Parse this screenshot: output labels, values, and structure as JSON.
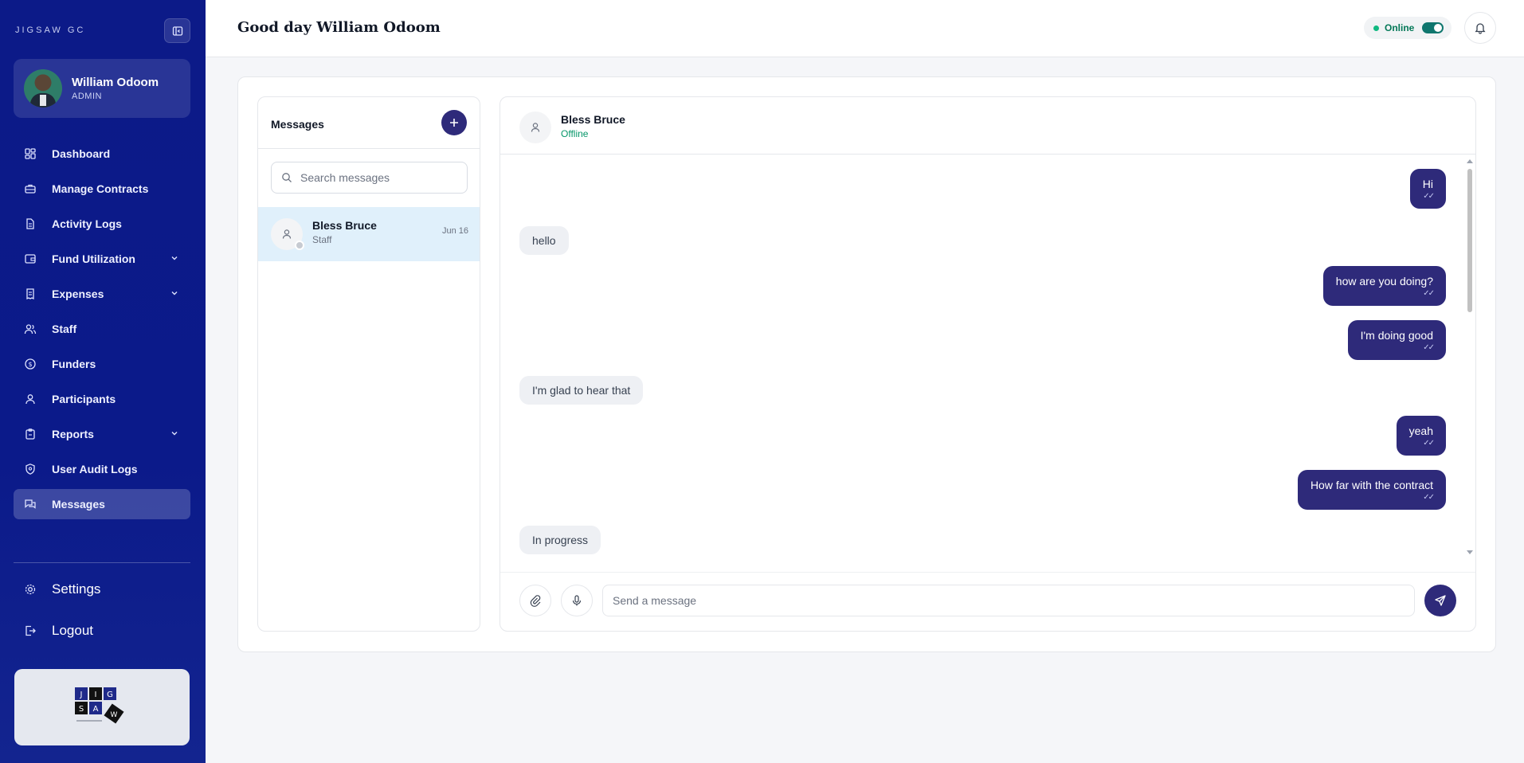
{
  "app": {
    "brand": "JIGSAW GC"
  },
  "user": {
    "name": "William Odoom",
    "role": "ADMIN"
  },
  "header": {
    "greeting": "Good day William Odoom",
    "status": "Online"
  },
  "sidebar": {
    "items": [
      {
        "label": "Dashboard",
        "icon": "dashboard-icon",
        "expandable": false
      },
      {
        "label": "Manage Contracts",
        "icon": "briefcase-icon",
        "expandable": false
      },
      {
        "label": "Activity Logs",
        "icon": "document-icon",
        "expandable": false
      },
      {
        "label": "Fund Utilization",
        "icon": "wallet-icon",
        "expandable": true
      },
      {
        "label": "Expenses",
        "icon": "receipt-icon",
        "expandable": true
      },
      {
        "label": "Staff",
        "icon": "users-icon",
        "expandable": false
      },
      {
        "label": "Funders",
        "icon": "dollar-icon",
        "expandable": false
      },
      {
        "label": "Participants",
        "icon": "user-icon",
        "expandable": false
      },
      {
        "label": "Reports",
        "icon": "clipboard-icon",
        "expandable": true
      },
      {
        "label": "User Audit Logs",
        "icon": "shield-icon",
        "expandable": false
      },
      {
        "label": "Messages",
        "icon": "chat-icon",
        "expandable": false,
        "active": true
      }
    ],
    "settings_label": "Settings",
    "logout_label": "Logout",
    "logo_letters": [
      "J",
      "I",
      "G",
      "S",
      "A",
      "W"
    ]
  },
  "messages_list": {
    "title": "Messages",
    "search_placeholder": "Search messages",
    "conversations": [
      {
        "name": "Bless Bruce",
        "role": "Staff",
        "date": "Jun 16"
      }
    ]
  },
  "chat": {
    "contact_name": "Bless Bruce",
    "contact_status": "Offline",
    "input_placeholder": "Send a message",
    "messages": [
      {
        "direction": "out",
        "text": "Hi"
      },
      {
        "direction": "in",
        "text": "hello"
      },
      {
        "direction": "out",
        "text": "how are you doing?"
      },
      {
        "direction": "out",
        "text": "I'm doing good"
      },
      {
        "direction": "in",
        "text": "I'm glad to hear that"
      },
      {
        "direction": "out",
        "text": "yeah"
      },
      {
        "direction": "out",
        "text": "How far with the contract"
      },
      {
        "direction": "in",
        "text": "In progress"
      }
    ]
  },
  "colors": {
    "sidebar": "#0c1a88",
    "accent": "#2e2a7a",
    "online": "#10b981",
    "selected_conversation": "#e0f0fb"
  }
}
